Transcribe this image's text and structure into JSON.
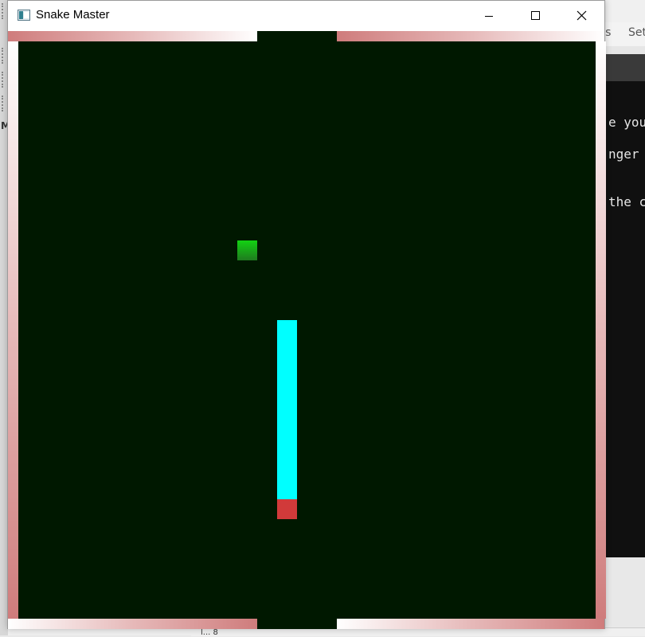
{
  "window": {
    "title": "Snake Master",
    "controls": {
      "minimize": "minimize-icon",
      "maximize": "maximize-icon",
      "close": "close-icon"
    }
  },
  "game": {
    "colors": {
      "arena": "#001800",
      "wall": "#cf7c7c",
      "food": "#12d212",
      "snake_body": "#00ffff",
      "snake_head": "#d13a3a"
    },
    "snake_direction": "down"
  },
  "background_app": {
    "menu_fragments": [
      "ks",
      "Set"
    ],
    "terminal_lines": [
      "e you",
      "nger y",
      "the c"
    ],
    "status_fragment": "l... 8"
  }
}
